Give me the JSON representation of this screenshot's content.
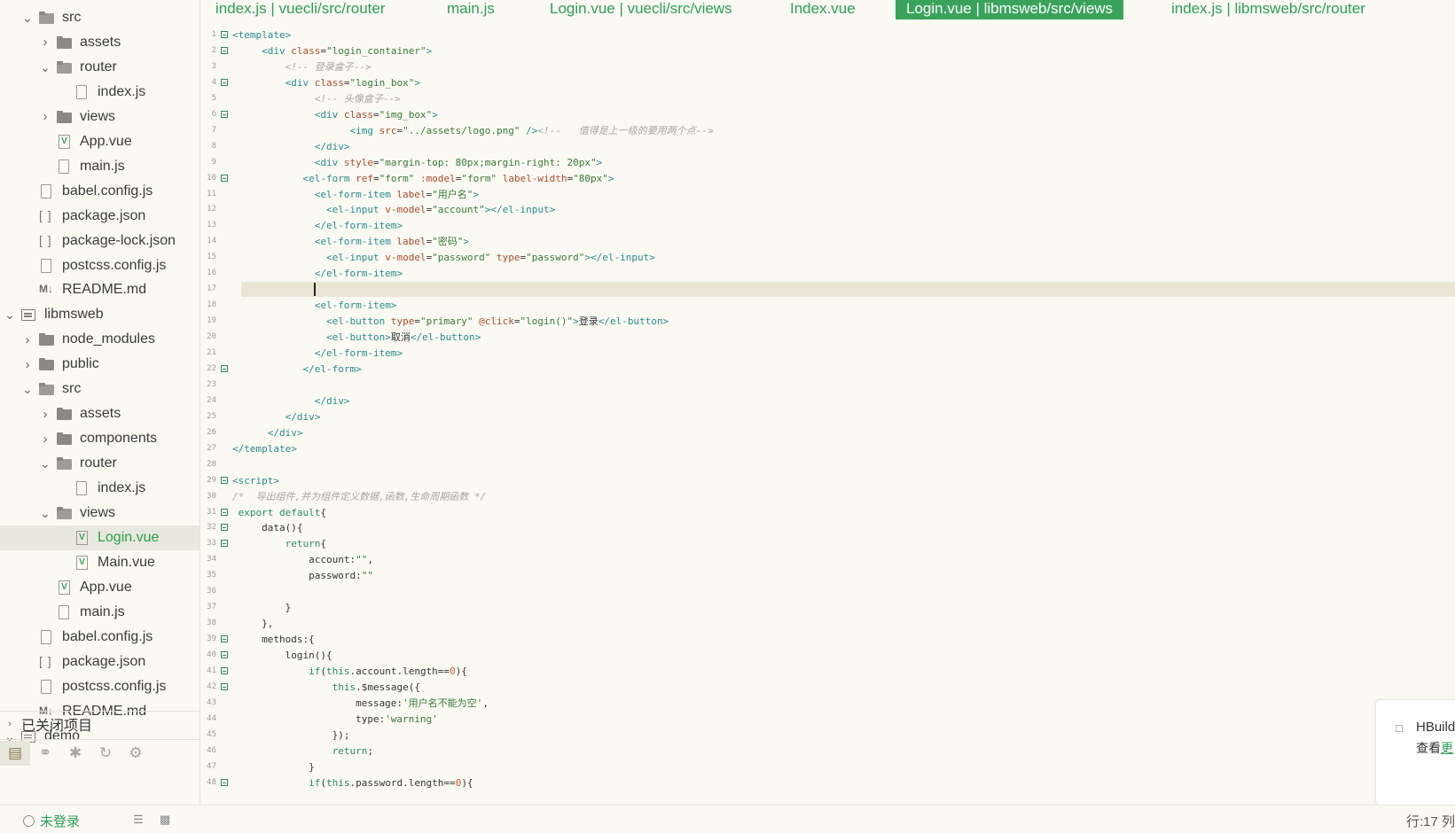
{
  "tabs": [
    {
      "label": "index.js | vuecli/src/router",
      "active": false
    },
    {
      "label": "main.js",
      "active": false
    },
    {
      "label": "Login.vue | vuecli/src/views",
      "active": false
    },
    {
      "label": "Index.vue",
      "active": false
    },
    {
      "label": "Login.vue | libmsweb/src/views",
      "active": true
    },
    {
      "label": "index.js | libmsweb/src/router",
      "active": false
    }
  ],
  "tree": [
    {
      "label": "src",
      "icon": "folder-open-icon",
      "chevron": "down",
      "depth": 1
    },
    {
      "label": "assets",
      "icon": "folder-icon",
      "chevron": "right",
      "depth": 2
    },
    {
      "label": "router",
      "icon": "folder-open-icon",
      "chevron": "down",
      "depth": 2
    },
    {
      "label": "index.js",
      "icon": "js-file-icon",
      "chevron": "",
      "depth": 3
    },
    {
      "label": "views",
      "icon": "folder-icon",
      "chevron": "right",
      "depth": 2
    },
    {
      "label": "App.vue",
      "icon": "vue-file-icon",
      "chevron": "",
      "depth": 2
    },
    {
      "label": "main.js",
      "icon": "js-file-icon",
      "chevron": "",
      "depth": 2
    },
    {
      "label": "babel.config.js",
      "icon": "js-file-icon",
      "chevron": "",
      "depth": 1
    },
    {
      "label": "package.json",
      "icon": "json-file-icon",
      "chevron": "",
      "depth": 1
    },
    {
      "label": "package-lock.json",
      "icon": "json-file-icon",
      "chevron": "",
      "depth": 1
    },
    {
      "label": "postcss.config.js",
      "icon": "js-file-icon",
      "chevron": "",
      "depth": 1
    },
    {
      "label": "README.md",
      "icon": "markdown-file-icon",
      "chevron": "",
      "depth": 1
    },
    {
      "label": "libmsweb",
      "icon": "project-icon",
      "chevron": "down",
      "depth": 0
    },
    {
      "label": "node_modules",
      "icon": "folder-icon",
      "chevron": "right",
      "depth": 1
    },
    {
      "label": "public",
      "icon": "folder-icon",
      "chevron": "right",
      "depth": 1
    },
    {
      "label": "src",
      "icon": "folder-open-icon",
      "chevron": "down",
      "depth": 1
    },
    {
      "label": "assets",
      "icon": "folder-icon",
      "chevron": "right",
      "depth": 2
    },
    {
      "label": "components",
      "icon": "folder-icon",
      "chevron": "right",
      "depth": 2
    },
    {
      "label": "router",
      "icon": "folder-open-icon",
      "chevron": "down",
      "depth": 2
    },
    {
      "label": "index.js",
      "icon": "js-file-icon",
      "chevron": "",
      "depth": 3
    },
    {
      "label": "views",
      "icon": "folder-open-icon",
      "chevron": "down",
      "depth": 2
    },
    {
      "label": "Login.vue",
      "icon": "vue-file-icon",
      "chevron": "",
      "depth": 3,
      "active": true
    },
    {
      "label": "Main.vue",
      "icon": "vue-file-icon",
      "chevron": "",
      "depth": 3
    },
    {
      "label": "App.vue",
      "icon": "vue-file-icon",
      "chevron": "",
      "depth": 2
    },
    {
      "label": "main.js",
      "icon": "js-file-icon",
      "chevron": "",
      "depth": 2
    },
    {
      "label": "babel.config.js",
      "icon": "js-file-icon",
      "chevron": "",
      "depth": 1
    },
    {
      "label": "package.json",
      "icon": "json-file-icon",
      "chevron": "",
      "depth": 1
    },
    {
      "label": "postcss.config.js",
      "icon": "js-file-icon",
      "chevron": "",
      "depth": 1
    },
    {
      "label": "README.md",
      "icon": "markdown-file-icon",
      "chevron": "",
      "depth": 1
    },
    {
      "label": "demo",
      "icon": "project-icon",
      "chevron": "down",
      "depth": 0
    }
  ],
  "closed_projects": {
    "label": "已关闭项目"
  },
  "sidebar_tools": [
    "project-manager-icon",
    "search-binoculars-icon",
    "debug-bug-icon",
    "git-icon",
    "plugin-icon"
  ],
  "editor": {
    "current_line": 17,
    "lines": [
      {
        "n": 1,
        "fold": true,
        "code": "<template>"
      },
      {
        "n": 2,
        "fold": true,
        "code": "     <div class=\"login_container\">"
      },
      {
        "n": 3,
        "fold": false,
        "code": "         <!-- 登录盒子-->"
      },
      {
        "n": 4,
        "fold": true,
        "code": "         <div class=\"login_box\">"
      },
      {
        "n": 5,
        "fold": false,
        "code": "              <!-- 头像盒子-->"
      },
      {
        "n": 6,
        "fold": true,
        "code": "              <div class=\"img_box\">"
      },
      {
        "n": 7,
        "fold": false,
        "code": "                    <img src=\"../assets/logo.png\" /><!--   值得是上一级的要用两个点-->"
      },
      {
        "n": 8,
        "fold": false,
        "code": "              </div>"
      },
      {
        "n": 9,
        "fold": false,
        "code": "              <div style=\"margin-top: 80px;margin-right: 20px\">"
      },
      {
        "n": 10,
        "fold": true,
        "code": "            <el-form ref=\"form\" :model=\"form\" label-width=\"80px\">"
      },
      {
        "n": 11,
        "fold": false,
        "code": "              <el-form-item label=\"用户名\">"
      },
      {
        "n": 12,
        "fold": false,
        "code": "                <el-input v-model=\"account\"></el-input>"
      },
      {
        "n": 13,
        "fold": false,
        "code": "              </el-form-item>"
      },
      {
        "n": 14,
        "fold": false,
        "code": "              <el-form-item label=\"密码\">"
      },
      {
        "n": 15,
        "fold": false,
        "code": "                <el-input v-model=\"password\" type=\"password\"></el-input>"
      },
      {
        "n": 16,
        "fold": false,
        "code": "              </el-form-item>"
      },
      {
        "n": 17,
        "fold": false,
        "code": ""
      },
      {
        "n": 18,
        "fold": false,
        "code": "              <el-form-item>"
      },
      {
        "n": 19,
        "fold": false,
        "code": "                <el-button type=\"primary\" @click=\"login()\">登录</el-button>"
      },
      {
        "n": 20,
        "fold": false,
        "code": "                <el-button>取消</el-button>"
      },
      {
        "n": 21,
        "fold": false,
        "code": "              </el-form-item>"
      },
      {
        "n": 22,
        "fold": true,
        "code": "            </el-form>"
      },
      {
        "n": 23,
        "fold": false,
        "code": ""
      },
      {
        "n": 24,
        "fold": false,
        "code": "              </div>"
      },
      {
        "n": 25,
        "fold": false,
        "code": "         </div>"
      },
      {
        "n": 26,
        "fold": false,
        "code": "      </div>"
      },
      {
        "n": 27,
        "fold": false,
        "code": "</template>"
      },
      {
        "n": 28,
        "fold": false,
        "code": ""
      },
      {
        "n": 29,
        "fold": true,
        "code": "<script>"
      },
      {
        "n": 30,
        "fold": false,
        "code": "/*  导出组件,并为组件定义数据,函数,生命周期函数 */"
      },
      {
        "n": 31,
        "fold": true,
        "code": " export default{"
      },
      {
        "n": 32,
        "fold": true,
        "code": "     data(){"
      },
      {
        "n": 33,
        "fold": true,
        "code": "         return{"
      },
      {
        "n": 34,
        "fold": false,
        "code": "             account:\"\","
      },
      {
        "n": 35,
        "fold": false,
        "code": "             password:\"\""
      },
      {
        "n": 36,
        "fold": false,
        "code": ""
      },
      {
        "n": 37,
        "fold": false,
        "code": "         }"
      },
      {
        "n": 38,
        "fold": false,
        "code": "     },"
      },
      {
        "n": 39,
        "fold": true,
        "code": "     methods:{"
      },
      {
        "n": 40,
        "fold": true,
        "code": "         login(){"
      },
      {
        "n": 41,
        "fold": true,
        "code": "             if(this.account.length==0){"
      },
      {
        "n": 42,
        "fold": true,
        "code": "                 this.$message({"
      },
      {
        "n": 43,
        "fold": false,
        "code": "                     message:'用户名不能为空',"
      },
      {
        "n": 44,
        "fold": false,
        "code": "                     type:'warning'"
      },
      {
        "n": 45,
        "fold": false,
        "code": "                 });"
      },
      {
        "n": 46,
        "fold": false,
        "code": "                 return;"
      },
      {
        "n": 47,
        "fold": false,
        "code": "             }"
      },
      {
        "n": 48,
        "fold": true,
        "code": "             if(this.password.length==0){"
      }
    ]
  },
  "notification": {
    "title": "HBuild",
    "body_prefix": "查看",
    "link": "更"
  },
  "status": {
    "login": "未登录",
    "cursor": "行:17  列"
  },
  "colors": {
    "accent": "#3aa35b",
    "tab_text": "#2e9d58",
    "current_line": "#e9e5d5",
    "background": "#fafaf3"
  }
}
